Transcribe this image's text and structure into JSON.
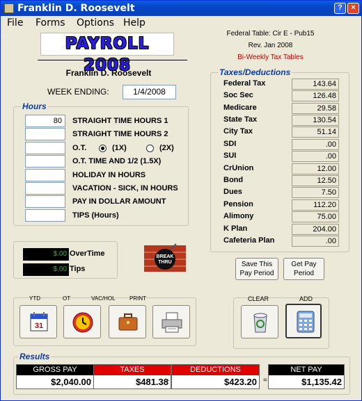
{
  "window": {
    "title": "Franklin D. Roosevelt",
    "help_glyph": "?",
    "close_glyph": "×"
  },
  "menu": [
    "File",
    "Forms",
    "Options",
    "Help"
  ],
  "logo_text": "PAYROLL 2008",
  "federal": {
    "table": "Federal Table: Cir E - Pub15",
    "rev": "Rev. Jan 2008",
    "schedule": "Bi-Weekly Tax Tables"
  },
  "employee_name": "Franklin D. Roosevelt",
  "week_ending": {
    "label": "WEEK ENDING:",
    "value": "1/4/2008"
  },
  "hours": {
    "title": "Hours",
    "rows": [
      {
        "value": "80",
        "label": "STRAIGHT TIME HOURS 1"
      },
      {
        "value": "",
        "label": "STRAIGHT TIME HOURS 2"
      },
      {
        "value": "",
        "label": "O.T."
      },
      {
        "value": "",
        "label": "O.T. TIME AND 1/2 (1.5X)"
      },
      {
        "value": "",
        "label": "HOLIDAY IN HOURS"
      },
      {
        "value": "",
        "label": "VACATION - SICK, IN HOURS"
      },
      {
        "value": "",
        "label": "PAY IN DOLLAR AMOUNT"
      },
      {
        "value": "",
        "label": "TIPS (Hours)"
      }
    ],
    "ot_options": [
      {
        "label": "(1X)",
        "selected": true
      },
      {
        "label": "(2X)",
        "selected": false
      }
    ]
  },
  "taxes": {
    "title": "Taxes/Deductions",
    "rows": [
      {
        "label": "Federal Tax",
        "value": "143.64"
      },
      {
        "label": "Soc Sec",
        "value": "126.48"
      },
      {
        "label": "Medicare",
        "value": "29.58"
      },
      {
        "label": "State Tax",
        "value": "130.54"
      },
      {
        "label": "City Tax",
        "value": "51.14"
      },
      {
        "label": "SDI",
        "value": ".00"
      },
      {
        "label": "SUI",
        "value": ".00"
      },
      {
        "label": "CrUnion",
        "value": "12.00"
      },
      {
        "label": "Bond",
        "value": "12.50"
      },
      {
        "label": "Dues",
        "value": "7.50"
      },
      {
        "label": "Pension",
        "value": "112.20"
      },
      {
        "label": "Alimony",
        "value": "75.00"
      },
      {
        "label": "K Plan",
        "value": "204.00"
      },
      {
        "label": "Cafeteria Plan",
        "value": ".00"
      }
    ]
  },
  "counters": {
    "overtime": {
      "label": "OverTime",
      "value": "$.00"
    },
    "tips": {
      "label": "Tips",
      "value": "$.00"
    }
  },
  "break_logo": "BREAK THRU SOFTWARE",
  "pay_period_buttons": {
    "save": "Save This Pay Period",
    "get": "Get Pay Period"
  },
  "tool_buttons": [
    {
      "caption": "YTD",
      "icon": "calendar-icon"
    },
    {
      "caption": "OT",
      "icon": "clock-icon"
    },
    {
      "caption": "VAC/HOL",
      "icon": "briefcase-icon"
    },
    {
      "caption": "PRINT",
      "icon": "printer-icon"
    }
  ],
  "action_buttons": [
    {
      "caption": "CLEAR",
      "icon": "recycle-bin-icon"
    },
    {
      "caption": "ADD",
      "icon": "calculator-icon"
    }
  ],
  "results": {
    "title": "Results",
    "gross": {
      "label": "GROSS PAY",
      "value": "$2,040.00"
    },
    "taxes": {
      "label": "TAXES",
      "value": "$481.38"
    },
    "deductions": {
      "label": "DEDUCTIONS",
      "value": "$423.20"
    },
    "net": {
      "label": "NET PAY",
      "value": "$1,135.42"
    },
    "ops": [
      "-",
      "-",
      "="
    ]
  },
  "colors": {
    "title_bar": "#0845c8",
    "group_title": "#0b3aa8",
    "red_header": "#e00000",
    "black_header": "#000000",
    "lcd_text": "#00d000",
    "fed_schedule": "#c00000"
  }
}
